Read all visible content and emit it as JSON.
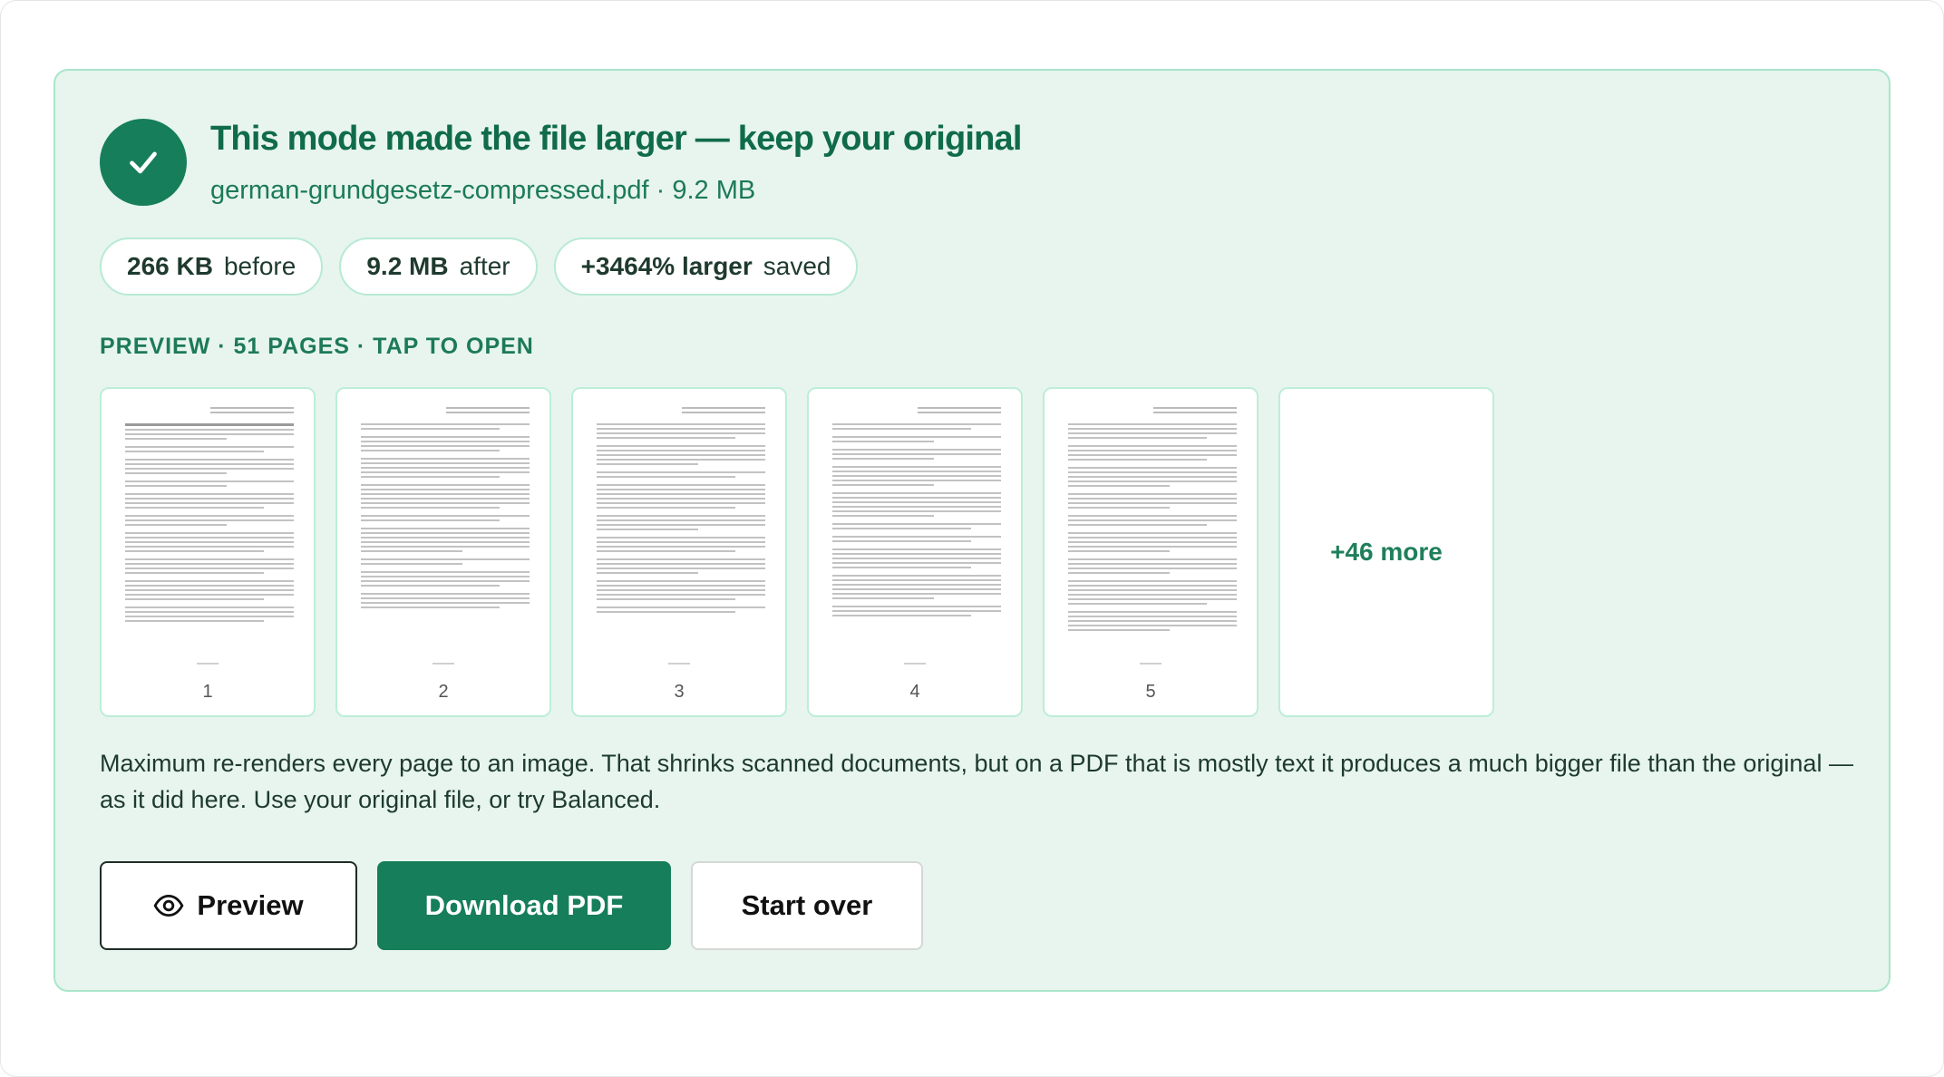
{
  "colors": {
    "accent": "#167e5a",
    "panel_background": "#e7f5ee",
    "panel_border": "#a9e6cb",
    "heading_text": "#106b4b"
  },
  "result": {
    "status_icon": "check-icon",
    "headline": "This mode made the file larger — keep your original",
    "file_line": "german-grundgesetz-compressed.pdf · 9.2 MB",
    "stats": [
      {
        "value": "266 KB",
        "label": "before"
      },
      {
        "value": "9.2 MB",
        "label": "after"
      },
      {
        "value": "+3464% larger",
        "label": "saved"
      }
    ]
  },
  "preview": {
    "heading": "PREVIEW · 51 PAGES · TAP TO OPEN",
    "pages": [
      {
        "number": "1"
      },
      {
        "number": "2"
      },
      {
        "number": "3"
      },
      {
        "number": "4"
      },
      {
        "number": "5"
      }
    ],
    "more_label": "+46 more"
  },
  "description": "Maximum re-renders every page to an image. That shrinks scanned documents, but on a PDF that is mostly text it produces a much bigger file than the original — as it did here. Use your original file, or try Balanced.",
  "actions": {
    "preview_label": "Preview",
    "preview_icon": "eye-icon",
    "download_label": "Download PDF",
    "start_over_label": "Start over"
  }
}
